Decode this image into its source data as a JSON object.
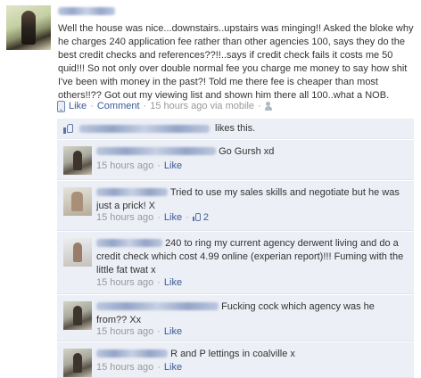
{
  "post": {
    "text": "Well the house was nice...downstairs..upstairs was minging!! Asked the bloke why he charges 240 application fee rather than other agencies 100, says they do the best credit checks and references??!!..says if credit check fails it costs me 50 quid!!! So not only over double normal fee you charge me money to say how shit I've been with money in the past?! Told me there fee is cheaper than most others!!?? Got out my viewing list and shown him there all 100..what a NOB.",
    "actions": {
      "like": "Like",
      "comment": "Comment",
      "separator": "·",
      "time": "15 hours ago via mobile",
      "separator2": "·"
    }
  },
  "likes": {
    "suffix": "likes this."
  },
  "comments": [
    {
      "text": "Go Gursh xd",
      "time": "15 hours ago",
      "sep": "·",
      "like": "Like"
    },
    {
      "text": "Tried to use my sales skills and negotiate but he was just a prick! X",
      "time": "15 hours ago",
      "sep": "·",
      "like": "Like",
      "sep2": "·",
      "like_count": "2"
    },
    {
      "text": "240 to ring my current agency derwent living and do a credit check which cost 4.99 online (experian report)!!! Fuming with the little fat twat x",
      "time": "15 hours ago",
      "sep": "·",
      "like": "Like"
    },
    {
      "text": "Fucking cock which agency was he from?? Xx",
      "time": "15 hours ago",
      "sep": "·",
      "like": "Like"
    },
    {
      "text": "R and P lettings in coalville x",
      "time": "15 hours ago",
      "sep": "·",
      "like": "Like"
    }
  ],
  "colors": {
    "link": "#3b5998",
    "comment_bg": "#eceff5",
    "meta": "#999999"
  }
}
